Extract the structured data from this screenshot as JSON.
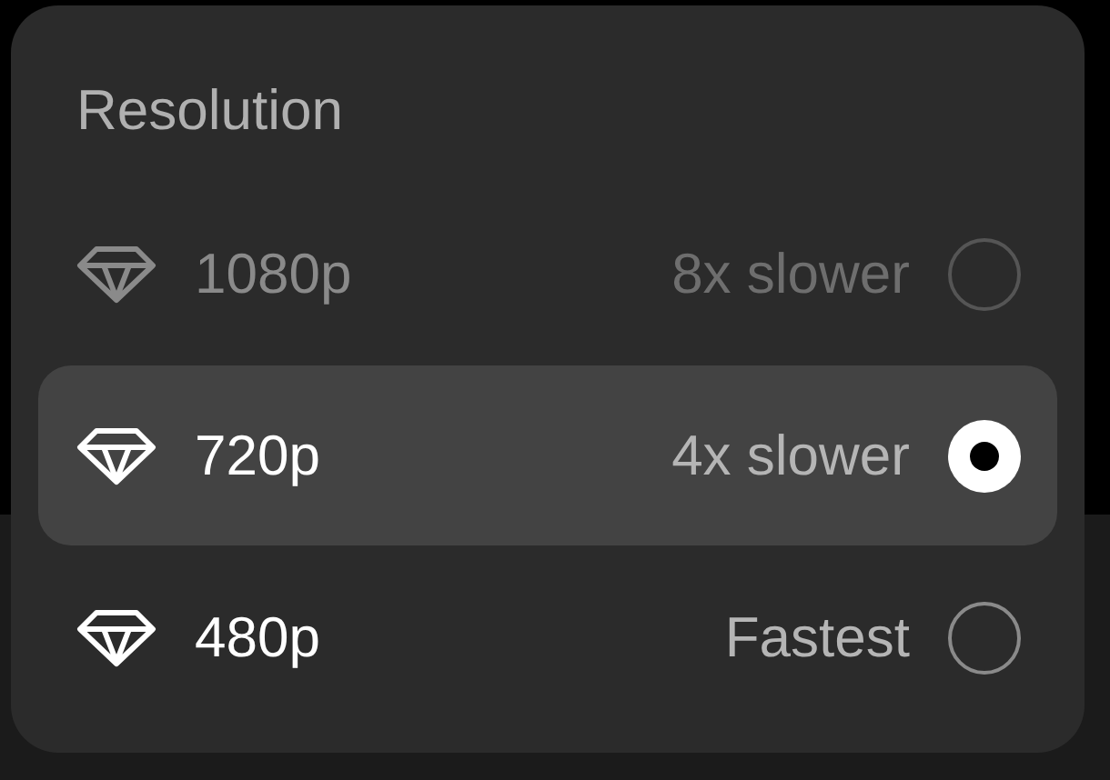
{
  "menu": {
    "title": "Resolution",
    "options": [
      {
        "label": "1080p",
        "note": "8x slower",
        "selected": false,
        "disabled": true
      },
      {
        "label": "720p",
        "note": "4x slower",
        "selected": true,
        "disabled": false
      },
      {
        "label": "480p",
        "note": "Fastest",
        "selected": false,
        "disabled": false
      }
    ]
  }
}
